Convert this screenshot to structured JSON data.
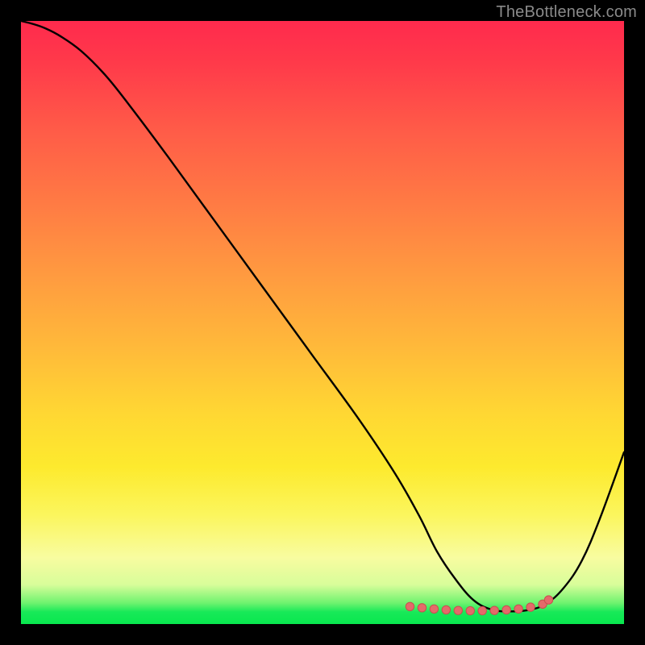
{
  "watermark": {
    "text": "TheBottleneck.com"
  },
  "colors": {
    "curve_stroke": "#000000",
    "marker_fill": "#e46a6a",
    "marker_stroke": "#c94f4f",
    "gradient_top": "#ff2a4d",
    "gradient_bottom": "#09e74e",
    "background": "#000000"
  },
  "chart_data": {
    "type": "line",
    "title": "",
    "xlabel": "",
    "ylabel": "",
    "xlim": [
      0,
      100
    ],
    "ylim": [
      0,
      100
    ],
    "grid": false,
    "legend": false,
    "annotations": [],
    "series": [
      {
        "name": "curve",
        "x": [
          0.0,
          2.0,
          4.0,
          6.5,
          10.0,
          14.0,
          18.0,
          24.0,
          32.0,
          40.0,
          48.0,
          56.0,
          62.0,
          66.0,
          69.0,
          72.0,
          75.0,
          78.0,
          81.0,
          84.0,
          87.0,
          90.0,
          93.0,
          96.0,
          100.0
        ],
        "y": [
          100.0,
          99.5,
          98.8,
          97.5,
          95.0,
          91.0,
          86.0,
          78.0,
          67.0,
          56.0,
          45.0,
          34.0,
          25.0,
          18.0,
          12.0,
          7.5,
          4.0,
          2.4,
          2.1,
          2.3,
          3.3,
          6.0,
          10.5,
          17.5,
          28.5
        ]
      }
    ],
    "markers": {
      "name": "valley-dots",
      "x": [
        64.5,
        66.5,
        68.5,
        70.5,
        72.5,
        74.5,
        76.5,
        78.5,
        80.5,
        82.5,
        84.5,
        86.5,
        87.5
      ],
      "y": [
        2.9,
        2.7,
        2.5,
        2.35,
        2.25,
        2.2,
        2.2,
        2.25,
        2.35,
        2.5,
        2.8,
        3.3,
        4.0
      ]
    }
  }
}
